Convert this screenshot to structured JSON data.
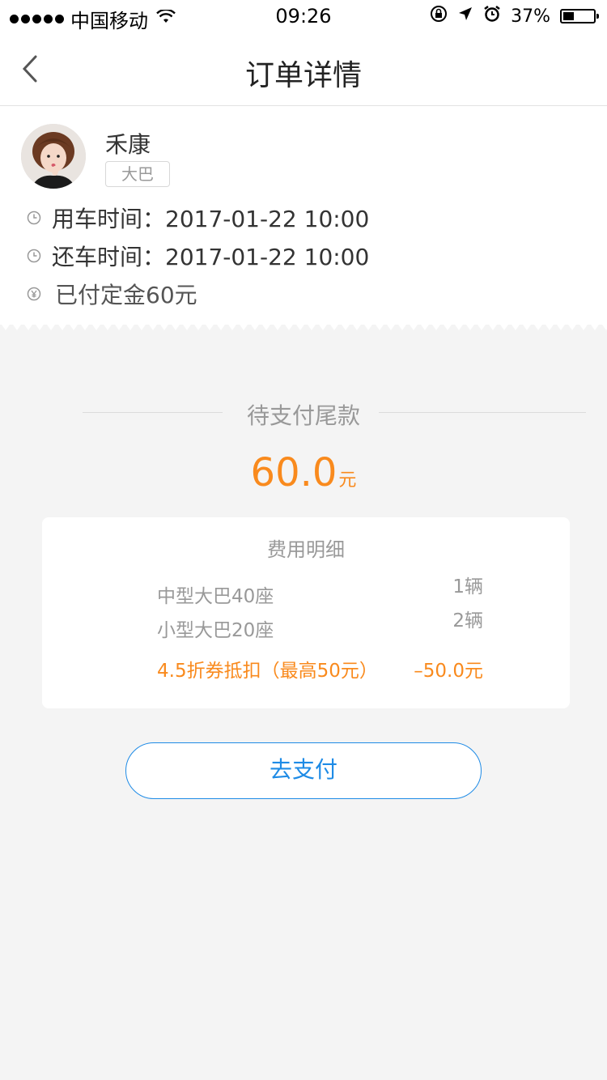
{
  "status_bar": {
    "carrier": "中国移动",
    "time": "09:26",
    "battery": "37%",
    "battery_level": 0.37
  },
  "nav": {
    "title": "订单详情"
  },
  "user": {
    "name": "禾康",
    "vehicle_tag": "大巴"
  },
  "order": {
    "use_time": "用车时间：2017-01-22 10:00",
    "return_time": "还车时间：2017-01-22 10:00",
    "deposit": "已付定金60元"
  },
  "pending": {
    "label": "待支付尾款",
    "amount": "60.0",
    "unit": "元"
  },
  "fee_detail": {
    "title": "费用明细",
    "items": [
      {
        "name": "中型大巴40座",
        "qty": "1辆"
      },
      {
        "name": "小型大巴20座",
        "qty": "2辆"
      }
    ],
    "discount_label": "4.5折券抵扣（最高50元）",
    "discount_value": "–50.0元"
  },
  "pay_button": {
    "label": "去支付"
  },
  "colors": {
    "accent_orange": "#f98a1d",
    "accent_blue": "#1e8be6",
    "background": "#f4f4f4"
  }
}
